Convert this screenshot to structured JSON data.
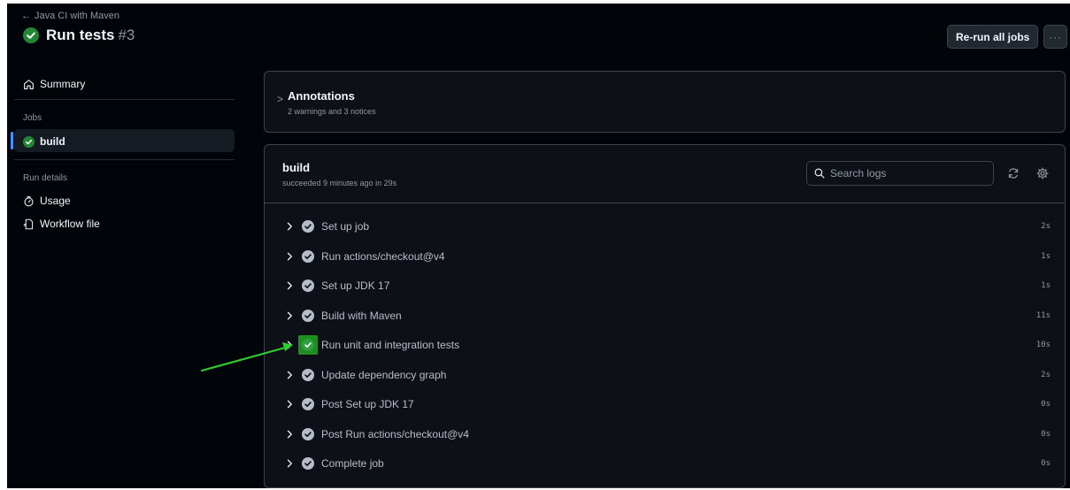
{
  "header": {
    "back_label": "Java CI with Maven",
    "run_name": "Run tests",
    "run_number": "#3",
    "rerun_label": "Re-run all jobs",
    "more_label": "···"
  },
  "sidebar": {
    "summary_label": "Summary",
    "jobs_heading": "Jobs",
    "job_name": "build",
    "run_details_heading": "Run details",
    "usage_label": "Usage",
    "workflow_file_label": "Workflow file"
  },
  "annotations": {
    "title": "Annotations",
    "subtitle": "2 warnings and 3 notices"
  },
  "job": {
    "title": "build",
    "subtitle": "succeeded 9 minutes ago in 29s",
    "search_placeholder": "Search logs"
  },
  "steps": [
    {
      "name": "Set up job",
      "duration": "2s"
    },
    {
      "name": "Run actions/checkout@v4",
      "duration": "1s"
    },
    {
      "name": "Set up JDK 17",
      "duration": "1s"
    },
    {
      "name": "Build with Maven",
      "duration": "11s"
    },
    {
      "name": "Run unit and integration tests",
      "duration": "10s"
    },
    {
      "name": "Update dependency graph",
      "duration": "2s"
    },
    {
      "name": "Post Set up JDK 17",
      "duration": "0s"
    },
    {
      "name": "Post Run actions/checkout@v4",
      "duration": "0s"
    },
    {
      "name": "Complete job",
      "duration": "0s"
    }
  ],
  "colors": {
    "success": "#238636",
    "highlight": "#1f8d1f",
    "arrow": "#2fcc2f",
    "accent": "#4493f8"
  }
}
